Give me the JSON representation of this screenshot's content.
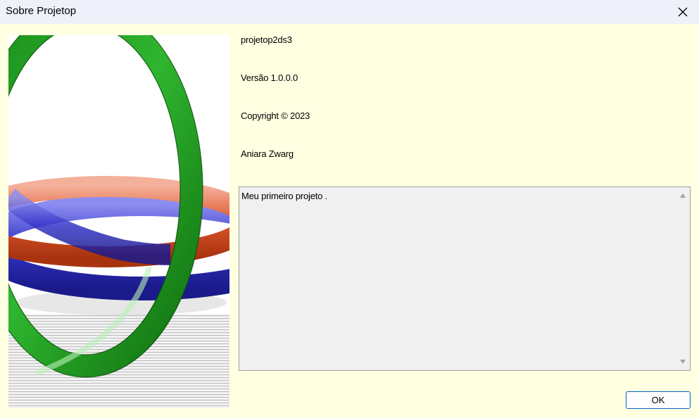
{
  "window": {
    "title": "Sobre Projetop",
    "close_icon": "close-icon"
  },
  "about": {
    "product_name": "projetop2ds3",
    "version": "Versão 1.0.0.0",
    "copyright": "Copyright ©  2023",
    "company": "Aniara Zwarg",
    "description": "Meu primeiro projeto ."
  },
  "buttons": {
    "ok_label": "OK"
  },
  "colors": {
    "client_background": "#ffffe1",
    "titlebar_background": "#eef1f9",
    "button_border": "#0067c0"
  }
}
